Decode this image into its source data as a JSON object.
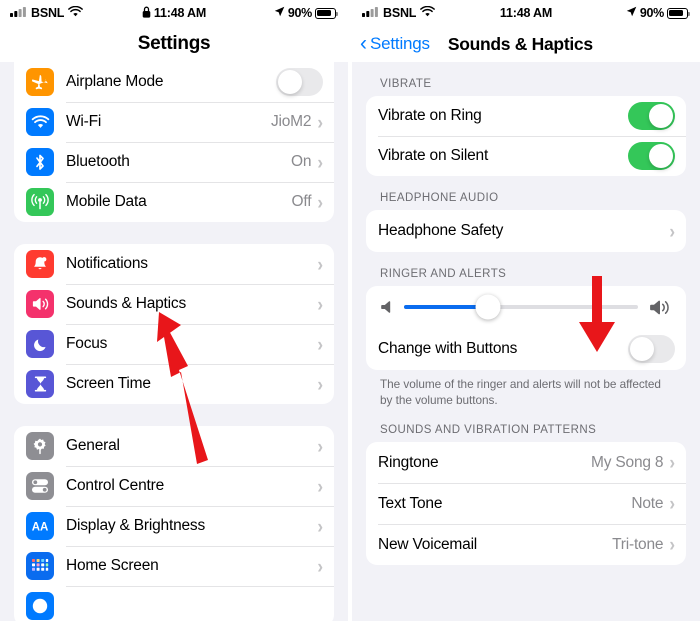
{
  "accent": "#007AFF",
  "status_bar": {
    "carrier": "BSNL",
    "wifi_icon": "wifi-icon",
    "signal_icon": "cellular-signal-icon",
    "lock_icon": "lock-icon",
    "time": "11:48 AM",
    "location_icon": "location-arrow-icon",
    "battery_percent": "90%",
    "battery_icon": "battery-icon"
  },
  "left_pane": {
    "nav_title": "Settings",
    "groups": [
      {
        "name": "connectivity",
        "rows": [
          {
            "label": "Airplane Mode",
            "icon": "airplane-icon",
            "icon_color": "#FF9500",
            "control": "toggle",
            "toggle_on": false
          },
          {
            "label": "Wi-Fi",
            "icon": "wifi-icon",
            "icon_color": "#007AFF",
            "control": "value",
            "value": "JioM2"
          },
          {
            "label": "Bluetooth",
            "icon": "bluetooth-icon",
            "icon_color": "#007AFF",
            "control": "value",
            "value": "On"
          },
          {
            "label": "Mobile Data",
            "icon": "mobile-data-icon",
            "icon_color": "#34C759",
            "control": "value",
            "value": "Off"
          }
        ]
      },
      {
        "name": "alerts",
        "rows": [
          {
            "label": "Notifications",
            "icon": "bell-icon",
            "icon_color": "#FF3B30",
            "control": "chevron"
          },
          {
            "label": "Sounds & Haptics",
            "icon": "speaker-waves-icon",
            "icon_color": "#F4326C",
            "control": "chevron"
          },
          {
            "label": "Focus",
            "icon": "moon-icon",
            "icon_color": "#5856D6",
            "control": "chevron"
          },
          {
            "label": "Screen Time",
            "icon": "hourglass-icon",
            "icon_color": "#5856D6",
            "control": "chevron"
          }
        ]
      },
      {
        "name": "system",
        "rows": [
          {
            "label": "General",
            "icon": "gear-icon",
            "icon_color": "#8E8E93",
            "control": "chevron"
          },
          {
            "label": "Control Centre",
            "icon": "toggles-icon",
            "icon_color": "#8E8E93",
            "control": "chevron"
          },
          {
            "label": "Display & Brightness",
            "icon": "text-size-icon",
            "icon_color": "#007AFF",
            "control": "chevron"
          },
          {
            "label": "Home Screen",
            "icon": "app-grid-icon",
            "icon_color": "#0A6CEF",
            "control": "chevron"
          }
        ]
      }
    ]
  },
  "right_pane": {
    "back_label": "Settings",
    "back_icon": "chevron-left-icon",
    "nav_title": "Sounds & Haptics",
    "sections": [
      {
        "header": "VIBRATE",
        "rows": [
          {
            "label": "Vibrate on Ring",
            "control": "toggle",
            "toggle_on": true
          },
          {
            "label": "Vibrate on Silent",
            "control": "toggle",
            "toggle_on": true
          }
        ]
      },
      {
        "header": "HEADPHONE AUDIO",
        "rows": [
          {
            "label": "Headphone Safety",
            "control": "chevron"
          }
        ]
      },
      {
        "header": "RINGER AND ALERTS",
        "slider": {
          "name": "ringer-volume-slider",
          "value_percent": 36,
          "low_icon": "speaker-low-icon",
          "high_icon": "speaker-high-icon"
        },
        "rows": [
          {
            "label": "Change with Buttons",
            "control": "toggle",
            "toggle_on": false
          }
        ],
        "footer": "The volume of the ringer and alerts will not be affected by the volume buttons."
      },
      {
        "header": "SOUNDS AND VIBRATION PATTERNS",
        "rows": [
          {
            "label": "Ringtone",
            "control": "value",
            "value": "My Song 8"
          },
          {
            "label": "Text Tone",
            "control": "value",
            "value": "Note"
          },
          {
            "label": "New Voicemail",
            "control": "value",
            "value": "Tri-tone"
          }
        ]
      }
    ]
  },
  "annotations": [
    {
      "name": "arrow-pointing-sounds-haptics",
      "color": "#E8161A",
      "target": "Sounds & Haptics row"
    },
    {
      "name": "arrow-pointing-ringer-slider",
      "color": "#E8161A",
      "target": "Ringer and Alerts slider"
    }
  ]
}
